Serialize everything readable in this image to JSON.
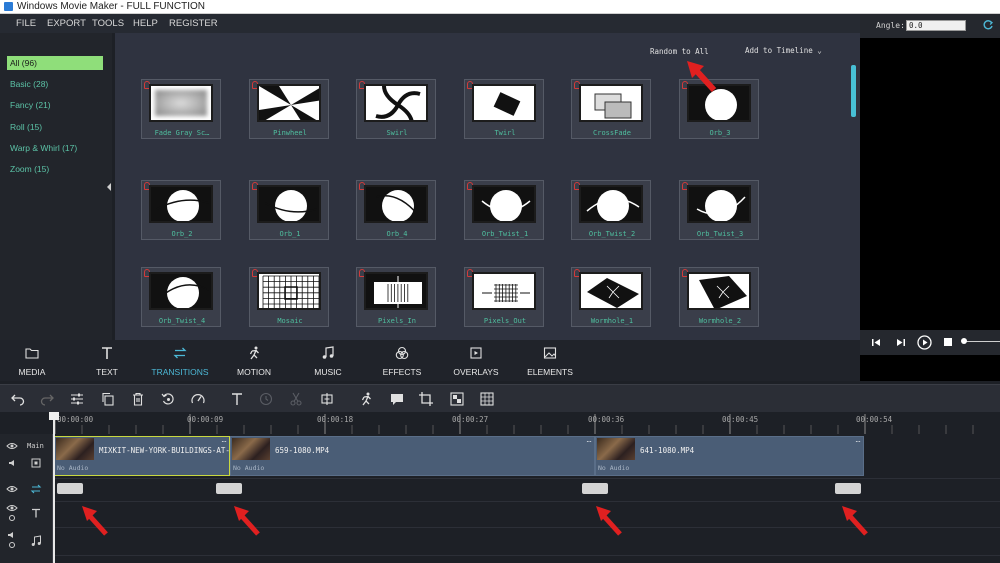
{
  "window": {
    "title": "Windows Movie Maker - FULL FUNCTION"
  },
  "menu": [
    "FILE",
    "EXPORT",
    "TOOLS",
    "HELP",
    "REGISTER"
  ],
  "categories": [
    {
      "label": "All (96)",
      "active": true
    },
    {
      "label": "Basic (28)",
      "active": false
    },
    {
      "label": "Fancy (21)",
      "active": false
    },
    {
      "label": "Roll (15)",
      "active": false
    },
    {
      "label": "Warp & Whirl (17)",
      "active": false
    },
    {
      "label": "Zoom (15)",
      "active": false
    }
  ],
  "library": {
    "random_label": "Random to All",
    "add_timeline_label": "Add to Timeline ⌄",
    "transitions": [
      "Fade Gray Sc…",
      "Pinwheel",
      "Swirl",
      "Twirl",
      "CrossFade",
      "Orb_3",
      "Orb_2",
      "Orb_1",
      "Orb_4",
      "Orb_Twist_1",
      "Orb_Twist_2",
      "Orb_Twist_3",
      "Orb_Twist_4",
      "Mosaic",
      "Pixels_In",
      "Pixels_Out",
      "Wormhole_1",
      "Wormhole_2"
    ]
  },
  "preview": {
    "angle_label": "Angle:",
    "angle_value": "0.0"
  },
  "tabs": [
    {
      "label": "MEDIA",
      "icon": "folder-icon",
      "active": false
    },
    {
      "label": "TEXT",
      "icon": "text-icon",
      "active": false
    },
    {
      "label": "TRANSITIONS",
      "icon": "transitions-icon",
      "active": true
    },
    {
      "label": "MOTION",
      "icon": "motion-icon",
      "active": false
    },
    {
      "label": "MUSIC",
      "icon": "music-icon",
      "active": false
    },
    {
      "label": "EFFECTS",
      "icon": "effects-icon",
      "active": false
    },
    {
      "label": "OVERLAYS",
      "icon": "overlays-icon",
      "active": false
    },
    {
      "label": "ELEMENTS",
      "icon": "elements-icon",
      "active": false
    }
  ],
  "toolbar_icons": [
    "undo-icon",
    "redo-icon",
    "settings-icon",
    "copy-icon",
    "delete-icon",
    "rotate-icon",
    "speed-icon",
    "text-tool-icon",
    "clock-icon",
    "cut-icon",
    "split-icon",
    "motion-tool-icon",
    "caption-icon",
    "crop-icon",
    "mosaic-icon",
    "grid-icon"
  ],
  "ruler": [
    "00:00:00",
    "00:00:09",
    "00:00:18",
    "00:00:27",
    "00:00:36",
    "00:00:45",
    "00:00:54"
  ],
  "tracks": {
    "main_label": "Main",
    "clips": [
      {
        "name": "MIXKIT-NEW-YORK-BUILDINGS-AT-",
        "audio": "No Audio",
        "selected": true
      },
      {
        "name": "659-1080.MP4",
        "audio": "No Audio",
        "selected": false
      },
      {
        "name": "641-1080.MP4",
        "audio": "No Audio",
        "selected": false
      }
    ],
    "clip_more": "···"
  },
  "colors": {
    "accent": "#4cb8d6",
    "category_active": "#8fde7a",
    "label_green": "#4fbf9f",
    "arrow_red": "#e02020"
  }
}
